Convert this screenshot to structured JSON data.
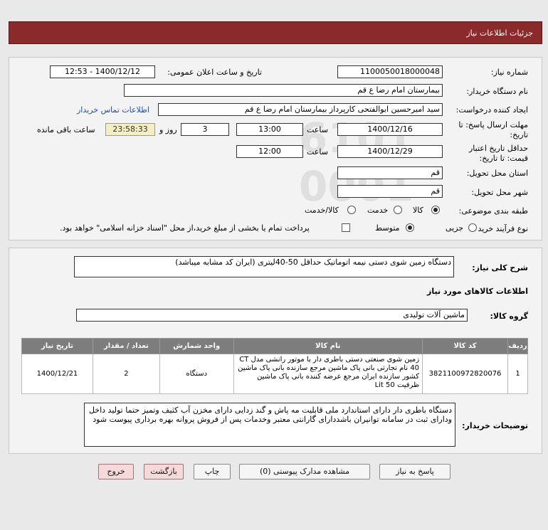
{
  "header": {
    "title": "جزئیات اطلاعات نیاز"
  },
  "form": {
    "need_number_label": "شماره نیاز:",
    "need_number": "1100050018000048",
    "announce_label": "تاریخ و ساعت اعلان عمومی:",
    "announce_value": "1400/12/12 - 12:53",
    "buyer_org_label": "نام دستگاه خریدار:",
    "buyer_org": "بیمارستان امام رضا ع  قم",
    "requester_label": "ایجاد کننده درخواست:",
    "requester": "سید امیرحسین ابوالفتحی کارپرداز بیمارستان امام رضا ع  قم",
    "contact_link": "اطلاعات تماس خریدار",
    "deadline_label_1": "مهلت ارسال پاسخ: تا",
    "deadline_label_2": "تاریخ:",
    "deadline_date": "1400/12/16",
    "time_label": "ساعت",
    "deadline_time": "13:00",
    "days_value": "3",
    "days_label": "روز و",
    "remaining_time": "23:58:33",
    "remaining_label": "ساعت باقی مانده",
    "validity_label_1": "حداقل تاریخ اعتبار",
    "validity_label_2": "قیمت: تا تاریخ:",
    "validity_date": "1400/12/29",
    "validity_time_label": "ساعت",
    "validity_time": "12:00",
    "province_label": "استان محل تحویل:",
    "province": "قم",
    "city_label": "شهر محل تحویل:",
    "city": "قم",
    "category_label": "طبقه بندی موضوعی:",
    "category_options": [
      "کالا",
      "خدمت",
      "کالا/خدمت"
    ],
    "process_label": "نوع فرآیند خرید :",
    "process_options": [
      "جزیی",
      "متوسط"
    ],
    "payment_note": "پرداخت تمام یا بخشی از مبلغ خرید،از محل \"اسناد خزانه اسلامی\" خواهد بود."
  },
  "need": {
    "summary_label": "شرح کلی نیاز:",
    "summary": "دستگاه زمین شوی دستی نیمه اتوماتیک حداقل 50-40لیتری  (ایران کد مشابه میباشد)",
    "goods_info_title": "اطلاعات کالاهای مورد نیاز",
    "goods_group_label": "گروه کالا:",
    "goods_group": "ماشین آلات تولیدی"
  },
  "table": {
    "headers": [
      "ردیف",
      "کد کالا",
      "نام کالا",
      "واحد شمارش",
      "تعداد / مقدار",
      "تاریخ نیاز"
    ],
    "rows": [
      {
        "row": "1",
        "code": "3821100972820076",
        "name": "زمین شوی صنعتی دستی باطری دار با موتور رانشی مدل CT 40 نام تجارتی بانی پاک ماشین مرجع سازنده بانی پاک ماشین کشور سازنده ایران مرجع عرضه کننده بانی پاک ماشین ظرفیت 50 Lit",
        "unit": "دستگاه",
        "qty": "2",
        "date": "1400/12/21"
      }
    ]
  },
  "buyer_notes": {
    "label": "توضیحات خریدار:",
    "text": "دستگاه باطری دار دارای استاندارد ملی قابلیت مه پاش و گند زدایی دارای مخزن آب کثیف وتمیز حتما تولید داخل ودارای ثبت در سامانه توانیران باشددارای گارانتی معتبر وخدمات پس از فروش پروانه بهره برداری پیوست شود"
  },
  "buttons": {
    "reply": "پاسخ به نیاز",
    "attachments": "مشاهده مدارک پیوستی (0)",
    "print": "چاپ",
    "back": "بازگشت",
    "exit": "خروج"
  }
}
